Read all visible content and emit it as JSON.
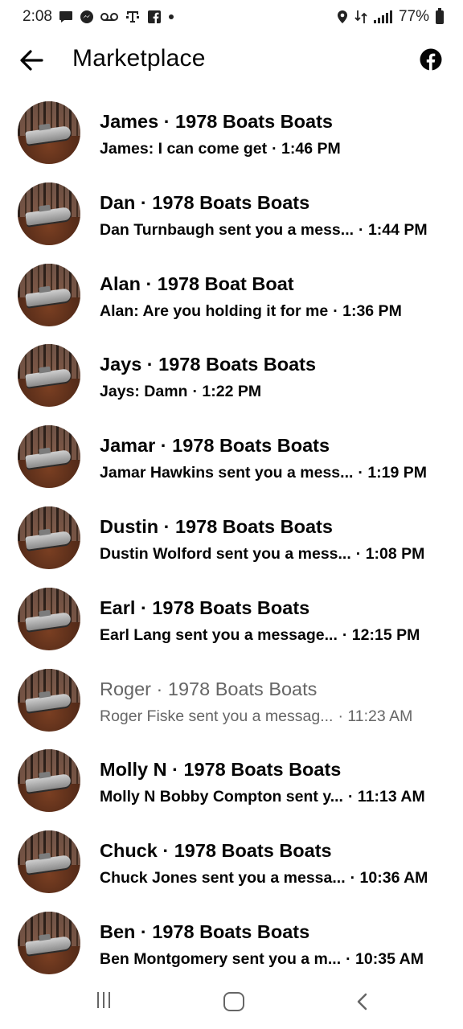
{
  "status_bar": {
    "time": "2:08",
    "battery": "77%",
    "left_icons": [
      "chat-bubble-icon",
      "messenger-icon",
      "voicemail-icon",
      "tmobile-icon",
      "facebook-square-icon",
      "dot-icon"
    ],
    "right_icons": [
      "location-icon",
      "data-transfer-icon",
      "signal-icon",
      "battery-icon"
    ]
  },
  "header": {
    "title": "Marketplace",
    "back_icon": "arrow-left-icon",
    "brand_icon": "facebook-icon"
  },
  "conversations": [
    {
      "name": "James · 1978 Boats Boats",
      "message": "James: I can come get",
      "time": "· 1:46 PM",
      "read": false
    },
    {
      "name": "Dan · 1978 Boats Boats",
      "message": "Dan Turnbaugh sent you a mess...",
      "time": "· 1:44 PM",
      "read": false
    },
    {
      "name": "Alan · 1978 Boat Boat",
      "message": "Alan: Are you holding it for me",
      "time": "· 1:36 PM",
      "read": false
    },
    {
      "name": "Jays · 1978 Boats Boats",
      "message": "Jays: Damn",
      "time": "· 1:22 PM",
      "read": false
    },
    {
      "name": "Jamar · 1978 Boats Boats",
      "message": "Jamar Hawkins sent you a mess...",
      "time": "· 1:19 PM",
      "read": false
    },
    {
      "name": "Dustin · 1978 Boats Boats",
      "message": "Dustin Wolford sent you a mess...",
      "time": "· 1:08 PM",
      "read": false
    },
    {
      "name": "Earl · 1978 Boats Boats",
      "message": "Earl Lang sent you a message...",
      "time": "· 12:15 PM",
      "read": false
    },
    {
      "name": "Roger · 1978 Boats Boats",
      "message": "Roger Fiske sent you a messag...",
      "time": "· 11:23 AM",
      "read": true
    },
    {
      "name": "Molly N · 1978 Boats Boats",
      "message": "Molly N Bobby Compton sent y...",
      "time": "· 11:13 AM",
      "read": false
    },
    {
      "name": "Chuck · 1978 Boats Boats",
      "message": "Chuck Jones sent you a messa...",
      "time": "· 10:36 AM",
      "read": false
    },
    {
      "name": "Ben · 1978 Boats Boats",
      "message": "Ben Montgomery sent you a m...",
      "time": "· 10:35 AM",
      "read": false
    }
  ],
  "nav_bar": {
    "icons": [
      "recent-apps-icon",
      "home-icon",
      "back-icon"
    ]
  },
  "colors": {
    "text_primary": "#050505",
    "text_read": "#666666",
    "background": "#ffffff"
  }
}
